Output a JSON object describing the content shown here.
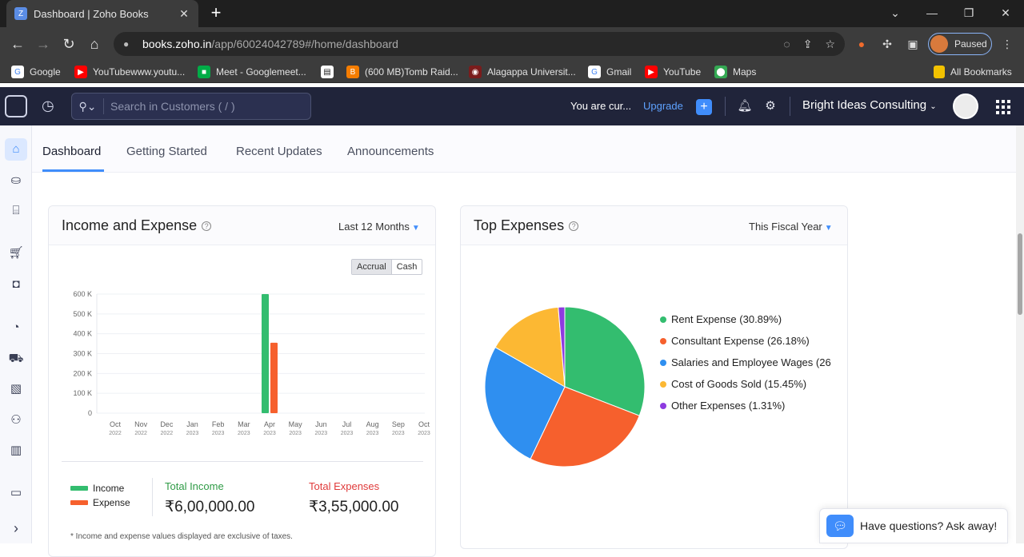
{
  "browser": {
    "tab_title": "Dashboard | Zoho Books",
    "url_host": "books.zoho.in",
    "url_path": "/app/60024042789#/home/dashboard",
    "profile_status": "Paused",
    "bookmarks": [
      {
        "label": "Google",
        "icon": "google-icon",
        "color": "#4285f4"
      },
      {
        "label": "YouTubewww.youtu...",
        "icon": "youtube-icon",
        "color": "#ff0000"
      },
      {
        "label": "Meet - Googlemeet...",
        "icon": "meet-icon",
        "color": "#00ac47"
      },
      {
        "label": "",
        "icon": "bookmark-page-icon",
        "color": "#ffffff"
      },
      {
        "label": "(600 MB)Tomb Raid...",
        "icon": "blogger-icon",
        "color": "#f57d00"
      },
      {
        "label": "Alagappa Universit...",
        "icon": "university-icon",
        "color": "#7a1c1c"
      },
      {
        "label": "Gmail",
        "icon": "google-icon",
        "color": "#4285f4"
      },
      {
        "label": "YouTube",
        "icon": "youtube-icon",
        "color": "#ff0000"
      },
      {
        "label": "Maps",
        "icon": "maps-icon",
        "color": "#34a853"
      }
    ],
    "all_bookmarks": "All Bookmarks"
  },
  "app": {
    "search_placeholder": "Search in Customers ( / )",
    "trial_text": "You are cur...",
    "upgrade_label": "Upgrade",
    "org_name": "Bright Ideas Consulting"
  },
  "tabs": [
    "Dashboard",
    "Getting Started",
    "Recent Updates",
    "Announcements"
  ],
  "income_expense": {
    "title": "Income and Expense",
    "period": "Last 12 Months",
    "toggle": [
      "Accrual",
      "Cash"
    ],
    "legend": [
      {
        "name": "Income",
        "color": "#33bd6f"
      },
      {
        "name": "Expense",
        "color": "#f6602d"
      }
    ],
    "total_income_label": "Total Income",
    "total_income_value": "₹6,00,000.00",
    "total_expense_label": "Total Expenses",
    "total_expense_value": "₹3,55,000.00",
    "income_label_color": "#2f9b46",
    "expense_label_color": "#e03a3a",
    "note": "* Income and expense values displayed are exclusive of taxes."
  },
  "top_expenses": {
    "title": "Top Expenses",
    "period": "This Fiscal Year"
  },
  "chat": {
    "text": "Have questions? Ask away!"
  },
  "chart_data": [
    {
      "type": "bar",
      "categories": [
        "Oct 2022",
        "Nov 2022",
        "Dec 2022",
        "Jan 2023",
        "Feb 2023",
        "Mar 2023",
        "Apr 2023",
        "May 2023",
        "Jun 2023",
        "Jul 2023",
        "Aug 2023",
        "Sep 2023",
        "Oct 2023"
      ],
      "category_months": [
        "Oct",
        "Nov",
        "Dec",
        "Jan",
        "Feb",
        "Mar",
        "Apr",
        "May",
        "Jun",
        "Jul",
        "Aug",
        "Sep",
        "Oct"
      ],
      "category_years": [
        "2022",
        "2022",
        "2022",
        "2023",
        "2023",
        "2023",
        "2023",
        "2023",
        "2023",
        "2023",
        "2023",
        "2023",
        "2023"
      ],
      "series": [
        {
          "name": "Income",
          "color": "#33bd6f",
          "values": [
            0,
            0,
            0,
            0,
            0,
            0,
            600000,
            0,
            0,
            0,
            0,
            0,
            0
          ]
        },
        {
          "name": "Expense",
          "color": "#f6602d",
          "values": [
            0,
            0,
            0,
            0,
            0,
            0,
            355000,
            0,
            0,
            0,
            0,
            0,
            0
          ]
        }
      ],
      "yticks": [
        "0",
        "100 K",
        "200 K",
        "300 K",
        "400 K",
        "500 K",
        "600 K"
      ],
      "ylim": [
        0,
        600000
      ],
      "grid": true
    },
    {
      "type": "pie",
      "labels": [
        "Rent Expense (30.89%)",
        "Consultant Expense (26.18%)",
        "Salaries and Employee Wages (26",
        "Cost of Goods Sold (15.45%)",
        "Other Expenses (1.31%)"
      ],
      "values": [
        30.89,
        26.18,
        26.17,
        15.45,
        1.31
      ],
      "colors": [
        "#33bd6f",
        "#f6602d",
        "#2f8ff0",
        "#fcb833",
        "#8e3be0"
      ],
      "legend": "right"
    }
  ]
}
